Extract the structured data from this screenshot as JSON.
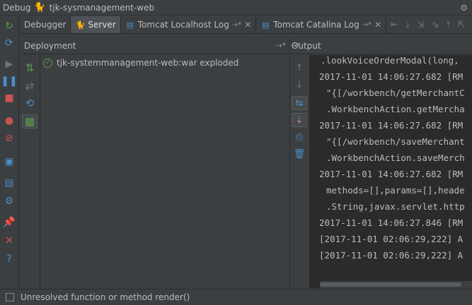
{
  "title_bar": {
    "label": "Debug",
    "project": "tjk-sysmanagement-web",
    "icon": "tomcat-icon"
  },
  "tabs": [
    {
      "label": "Debugger",
      "icon": ""
    },
    {
      "label": "Server",
      "icon": "tomcat-icon",
      "active": true
    },
    {
      "label": "Tomcat Localhost Log",
      "icon": "log-icon"
    },
    {
      "label": "Tomcat Catalina Log",
      "icon": "log-icon"
    }
  ],
  "deployment": {
    "header": "Deployment",
    "items": [
      {
        "label": "tjk-systemmanagement-web:war exploded",
        "status": "check-icon"
      }
    ]
  },
  "output": {
    "header": "Output",
    "lines": [
      ".lookVoiceOrderModal(long,",
      "2017-11-01 14:06:27.682 [RM",
      "\"{[/workbench/getMerchantC",
      ".WorkbenchAction.getMercha",
      "2017-11-01 14:06:27.682 [RM",
      "\"{[/workbench/saveMerchant",
      ".WorkbenchAction.saveMerch",
      "2017-11-01 14:06:27.682 [RM",
      "methods=[],params=[],heade",
      ".String,javax.servlet.http",
      "2017-11-01 14:06:27.846 [RM",
      "[2017-11-01 02:06:29,222] A",
      "[2017-11-01 02:06:29,222] A"
    ]
  },
  "status_bar": {
    "message": "Unresolved function or method render()"
  },
  "colors": {
    "background": "#3c3f41",
    "console_bg": "#2b2b2b",
    "text": "#bbbbbb",
    "green": "#5c9e4a",
    "blue": "#4b8ec8",
    "red": "#c75450"
  }
}
